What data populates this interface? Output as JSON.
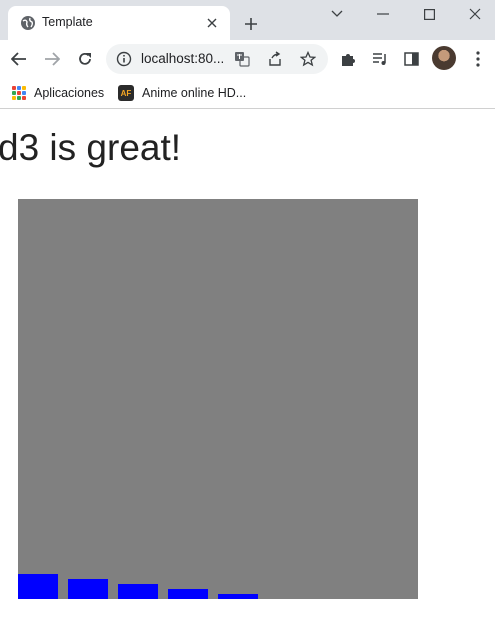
{
  "browser": {
    "tab": {
      "title": "Template"
    },
    "address_bar": {
      "url": "localhost:80..."
    },
    "bookmarks": [
      {
        "label": "Aplicaciones",
        "icon": "apps-grid-icon"
      },
      {
        "label": "Anime online HD...",
        "icon": "animeflv-icon"
      }
    ]
  },
  "page": {
    "heading": "d3 is great!"
  },
  "colors": {
    "chart_background": "#808080",
    "bar_fill": "#0000ff"
  },
  "chart_data": {
    "type": "bar",
    "values": [
      25,
      20,
      15,
      10,
      5
    ],
    "ylim": [
      0,
      400
    ],
    "grid": false,
    "axes": false
  }
}
